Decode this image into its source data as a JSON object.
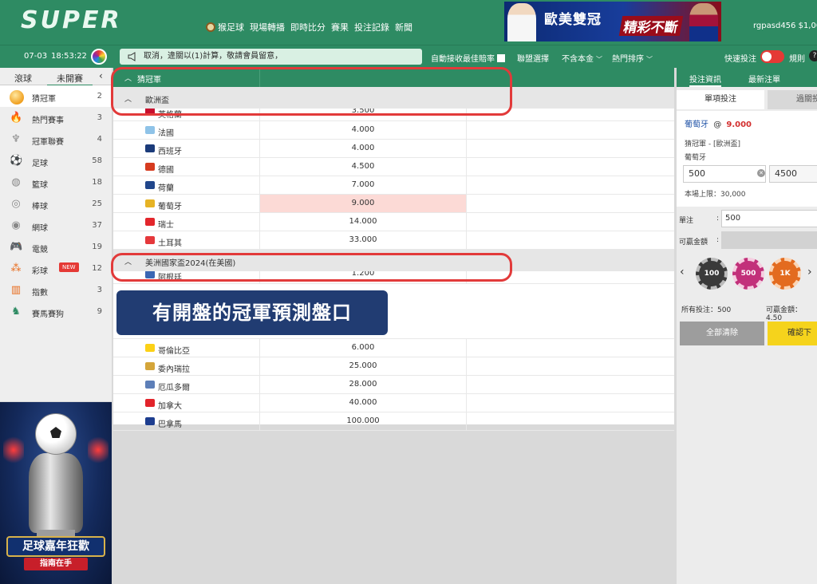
{
  "header": {
    "logo": "SUPER",
    "nav": [
      "猴足球",
      "現場轉播",
      "即時比分",
      "賽果",
      "投注記錄",
      "新聞"
    ],
    "banner": {
      "text1": "歐美雙冠",
      "text2": "精彩不斷"
    },
    "user": "rgpasd456   $1,00"
  },
  "toolbar": {
    "date": "07-03",
    "time": "18:53:22",
    "marquee": "取消，違關以(1)計算，敬請會員留意，",
    "auto_accept": "自動接收最佳賠率",
    "league_select": "聯盟選擇",
    "handicap": "不含本金",
    "sort": "熱門排序",
    "quick_bet": "快速投注",
    "rules": "規則",
    "help": "?"
  },
  "sidebar": {
    "tabs": [
      "滾球",
      "未開賽"
    ],
    "items": [
      {
        "label": "猜冠軍",
        "count": "2",
        "icon": "trophy-orb-icon"
      },
      {
        "label": "熱門賽事",
        "count": "3",
        "icon": "fire-icon"
      },
      {
        "label": "冠軍聯賽",
        "count": "4",
        "icon": "trophy-icon"
      },
      {
        "label": "足球",
        "count": "58",
        "icon": "soccer-icon"
      },
      {
        "label": "籃球",
        "count": "18",
        "icon": "basketball-icon"
      },
      {
        "label": "棒球",
        "count": "25",
        "icon": "baseball-icon"
      },
      {
        "label": "網球",
        "count": "37",
        "icon": "tennis-icon"
      },
      {
        "label": "電競",
        "count": "19",
        "icon": "gamepad-icon"
      },
      {
        "label": "彩球",
        "count": "12",
        "icon": "lottery-icon",
        "badge": "NEW"
      },
      {
        "label": "指數",
        "count": "3",
        "icon": "chart-icon"
      },
      {
        "label": "賽馬賽狗",
        "count": "9",
        "icon": "horse-icon"
      }
    ]
  },
  "promo": {
    "title": "足球嘉年狂歡",
    "sub": "指南在手"
  },
  "main": {
    "section_title": "猜冠軍",
    "groups": [
      {
        "title": "歐洲盃",
        "rows": [
          {
            "name": "英格蘭",
            "odds": "3.500",
            "flag": "#c8102e",
            "partial": true
          },
          {
            "name": "法國",
            "odds": "4.000",
            "flag": "#8fc3e8"
          },
          {
            "name": "西班牙",
            "odds": "4.000",
            "flag": "#1b3b7a"
          },
          {
            "name": "德國",
            "odds": "4.500",
            "flag": "#d63b1f"
          },
          {
            "name": "荷蘭",
            "odds": "7.000",
            "flag": "#21468b"
          },
          {
            "name": "葡萄牙",
            "odds": "9.000",
            "flag": "#e6b325",
            "selected": true
          },
          {
            "name": "瑞士",
            "odds": "14.000",
            "flag": "#e3262c"
          },
          {
            "name": "土耳其",
            "odds": "33.000",
            "flag": "#e5383b"
          }
        ]
      },
      {
        "title": "美洲國家盃2024(在美國)",
        "rows": [
          {
            "name": "阿根廷",
            "odds": "1.200",
            "flag": "#3a66b3",
            "partial": true
          },
          {
            "name": "哥倫比亞",
            "odds": "6.000",
            "flag": "#fcd116"
          },
          {
            "name": "委內瑞拉",
            "odds": "25.000",
            "flag": "#d4a53a"
          },
          {
            "name": "厄瓜多爾",
            "odds": "28.000",
            "flag": "#5d7fb8"
          },
          {
            "name": "加拿大",
            "odds": "40.000",
            "flag": "#e2242b"
          },
          {
            "name": "巴拿馬",
            "odds": "100.000",
            "flag": "#1d3d8f"
          }
        ]
      }
    ],
    "overlay_label": "有開盤的冠軍預測盤口"
  },
  "betslip": {
    "tabs": [
      "投注資訊",
      "最新注單"
    ],
    "sub_tabs": [
      "單項投注",
      "過關投"
    ],
    "selection": "葡萄牙",
    "at": "@",
    "odds": "9.000",
    "market": "猜冠軍 - [歐洲盃]",
    "pick": "葡萄牙",
    "stake": "500",
    "potential": "4500",
    "limit": "本場上限：30,000",
    "unit_label": "單注",
    "unit_value": "500",
    "win_label": "可贏金額",
    "chips": [
      "100",
      "500",
      "1K"
    ],
    "total_bet": "所有投注：500",
    "total_win": "可贏金額：4.50",
    "clear_all": "全部清除",
    "confirm": "確認下"
  }
}
